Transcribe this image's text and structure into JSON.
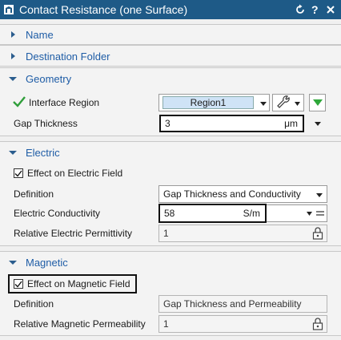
{
  "window": {
    "title": "Contact Resistance (one Surface)"
  },
  "sections": {
    "name": {
      "label": "Name"
    },
    "destination": {
      "label": "Destination Folder"
    },
    "geometry": {
      "label": "Geometry",
      "interface_region_label": "Interface Region",
      "interface_region_value": "Region1",
      "gap_thickness_label": "Gap Thickness",
      "gap_thickness_value": "3",
      "gap_thickness_unit": "μm"
    },
    "electric": {
      "label": "Electric",
      "effect_label": "Effect on Electric Field",
      "definition_label": "Definition",
      "definition_value": "Gap Thickness and Conductivity",
      "conductivity_label": "Electric Conductivity",
      "conductivity_value": "58",
      "conductivity_unit": "S/m",
      "permittivity_label": "Relative Electric Permittivity",
      "permittivity_value": "1"
    },
    "magnetic": {
      "label": "Magnetic",
      "effect_label": "Effect on Magnetic Field",
      "definition_label": "Definition",
      "definition_value": "Gap Thickness and Permeability",
      "permeability_label": "Relative Magnetic Permeability",
      "permeability_value": "1"
    }
  },
  "colors": {
    "titlebar": "#1e5a87",
    "section_label": "#1f5da6",
    "check_green": "#2f9e3a",
    "field_highlight": "#cfe3f6"
  }
}
